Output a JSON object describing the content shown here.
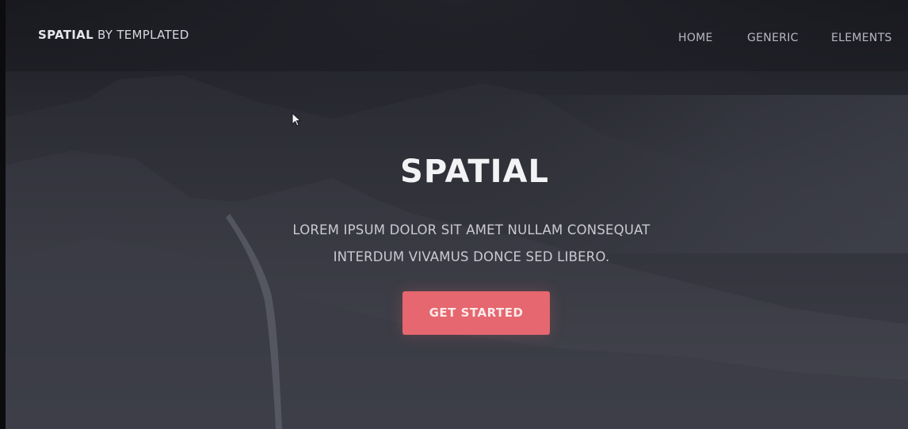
{
  "header": {
    "logo_bold": "SPATIAL",
    "logo_rest": " BY TEMPLATED",
    "nav": [
      "HOME",
      "GENERIC",
      "ELEMENTS"
    ]
  },
  "hero": {
    "title": "SPATIAL",
    "subtitle_line1": "LOREM IPSUM DOLOR SIT AMET NULLAM CONSEQUAT",
    "subtitle_line2": "INTERDUM VIVAMUS DONCE SED LIBERO.",
    "cta_label": "GET STARTED"
  },
  "colors": {
    "accent": "#e6676f",
    "background": "#2f3038"
  },
  "icons": {
    "cursor": "mouse-pointer-icon"
  }
}
